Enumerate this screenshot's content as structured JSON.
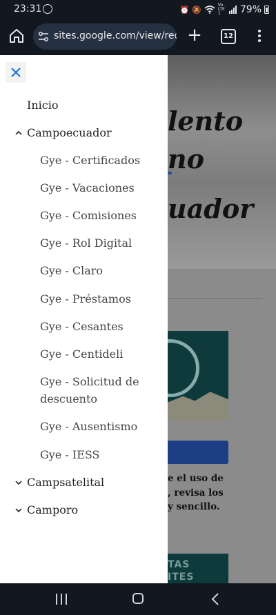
{
  "status_bar": {
    "time": "23:31",
    "network": "Vo LTE1",
    "battery": "79%"
  },
  "browser": {
    "url": "sites.google.com/view/requer",
    "tab_count": "12"
  },
  "page": {
    "hero_lines": [
      "lento",
      "no",
      "uador"
    ],
    "body_lines": [
      "e el uso de",
      ", revisa los",
      "y sencillo."
    ],
    "card_lines": [
      "TAS",
      "ITES"
    ]
  },
  "drawer": {
    "items": [
      {
        "label": "Inicio"
      },
      {
        "label": "Campoecuador",
        "expanded": true,
        "children": [
          {
            "label": "Gye - Certificados"
          },
          {
            "label": "Gye - Vacaciones"
          },
          {
            "label": "Gye - Comisiones"
          },
          {
            "label": "Gye - Rol Digital"
          },
          {
            "label": "Gye - Claro"
          },
          {
            "label": "Gye - Préstamos"
          },
          {
            "label": "Gye - Cesantes"
          },
          {
            "label": "Gye - Centideli"
          },
          {
            "label": "Gye - Solicitud de descuento",
            "lines": [
              "Gye - Solicitud de",
              "descuento"
            ]
          },
          {
            "label": "Gye - Ausentismo"
          },
          {
            "label": "Gye - IESS"
          }
        ]
      },
      {
        "label": "Campsatelital",
        "expanded": false
      },
      {
        "label": "Camporo",
        "expanded": false
      }
    ]
  },
  "colors": {
    "accent": "#1a73e8",
    "drawer_text": "#454545",
    "system_bar": "#121820"
  }
}
